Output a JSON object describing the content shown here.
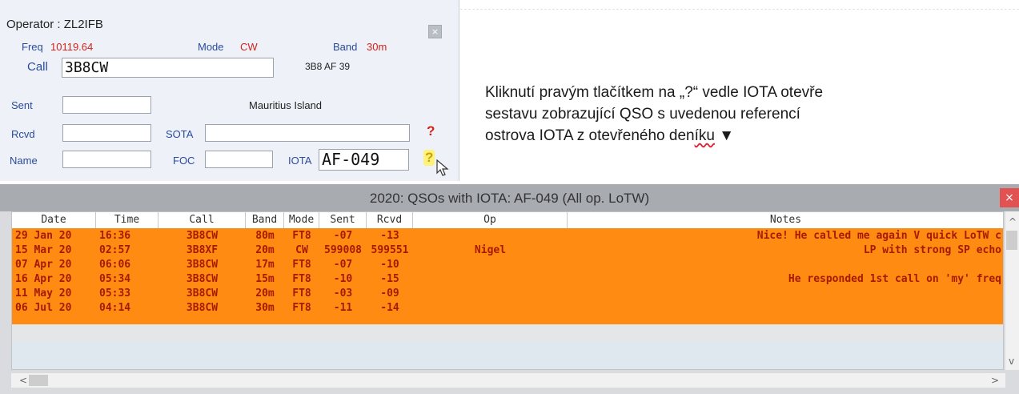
{
  "entry": {
    "title": "Operator : ZL2IFB",
    "close_glyph": "×",
    "freq_label": "Freq",
    "freq_value": "10119.64",
    "mode_label": "Mode",
    "mode_value": "CW",
    "band_label": "Band",
    "band_value": "30m",
    "call_label": "Call",
    "call_value": "3B8CW",
    "prefix_info": "3B8  AF  39",
    "sent_label": "Sent",
    "sent_value": "",
    "country": "Mauritius Island",
    "rcvd_label": "Rcvd",
    "rcvd_value": "",
    "sota_label": "SOTA",
    "sota_value": "",
    "sota_help": "?",
    "name_label": "Name",
    "name_value": "",
    "foc_label": "FOC",
    "foc_value": "",
    "iota_label": "IOTA",
    "iota_value": "AF-049",
    "iota_help": "?"
  },
  "annotation": {
    "line1": "Kliknutí pravým tlačítkem na „?“ vedle IOTA otevře",
    "line2": "sestavu zobrazující QSO s uvedenou referencí",
    "line3a": "ostrova IOTA z otevřeného den",
    "line3b": "íku",
    "line3c": " ▼"
  },
  "report": {
    "title": "2020: QSOs with IOTA: AF-049   (All op. LoTW)",
    "close_glyph": "×",
    "columns": [
      "Date",
      "Time",
      "Call",
      "Band",
      "Mode",
      "Sent",
      "Rcvd",
      "Op",
      "Notes"
    ],
    "rows": [
      [
        "29 Jan 20",
        "16:36",
        "3B8CW",
        "80m",
        "FT8",
        "-07",
        "-13",
        "",
        "Nice!  He called me again  V quick LoTW c"
      ],
      [
        "15 Mar 20",
        "02:57",
        "3B8XF",
        "20m",
        "CW",
        "599008",
        "599551",
        "Nigel",
        "LP with strong SP echo"
      ],
      [
        "07 Apr 20",
        "06:06",
        "3B8CW",
        "17m",
        "FT8",
        "-07",
        "-10",
        "",
        ""
      ],
      [
        "16 Apr 20",
        "05:34",
        "3B8CW",
        "15m",
        "FT8",
        "-10",
        "-15",
        "",
        "He responded 1st call on 'my' freq"
      ],
      [
        "11 May 20",
        "05:33",
        "3B8CW",
        "20m",
        "FT8",
        "-03",
        "-09",
        "",
        ""
      ],
      [
        "06 Jul 20",
        "04:14",
        "3B8CW",
        "30m",
        "FT8",
        "-11",
        "-14",
        "",
        ""
      ]
    ],
    "scroll_left": "<",
    "scroll_right": ">",
    "scroll_up": "^",
    "scroll_down": "v"
  },
  "colors": {
    "row_bg": "#ff8b12",
    "row_text": "#a61a00",
    "label_blue": "#2a4b9b",
    "value_red": "#d2231a"
  }
}
